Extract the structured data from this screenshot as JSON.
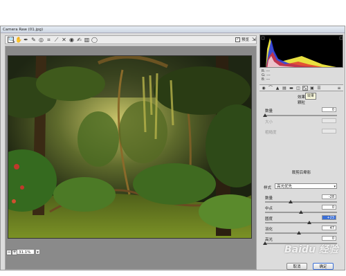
{
  "window": {
    "title": "Camera Raw (01.jpg)"
  },
  "toolbar": {
    "tools": [
      {
        "name": "zoom-tool-icon",
        "glyph": "🔍"
      },
      {
        "name": "hand-tool-icon",
        "glyph": "✋"
      },
      {
        "name": "white-balance-tool-icon",
        "glyph": "✒"
      },
      {
        "name": "color-sampler-tool-icon",
        "glyph": "✎"
      },
      {
        "name": "targeted-adjustment-tool-icon",
        "glyph": "◎"
      },
      {
        "name": "crop-tool-icon",
        "glyph": "⌗"
      },
      {
        "name": "straighten-tool-icon",
        "glyph": "⟋"
      },
      {
        "name": "spot-removal-tool-icon",
        "glyph": "✕"
      },
      {
        "name": "red-eye-tool-icon",
        "glyph": "◉"
      },
      {
        "name": "adjustment-brush-icon",
        "glyph": "✍"
      },
      {
        "name": "graduated-filter-icon",
        "glyph": "▥"
      },
      {
        "name": "radial-filter-icon",
        "glyph": "◯"
      }
    ],
    "preview_label": "预览",
    "preview_checked": "✓"
  },
  "status": {
    "zoom": "31.1%"
  },
  "histogram": {
    "readout": [
      "R: ---",
      "G: ---",
      "B: ---"
    ]
  },
  "panel_tabs": {
    "tooltip": "效果",
    "title": "效果"
  },
  "grain": {
    "heading": "颗粒",
    "amount_label": "数量",
    "amount_value": "0",
    "size_label": "大小",
    "roughness_label": "粗糙度"
  },
  "vignette": {
    "heading": "裁剪后晕影",
    "style_label": "样式",
    "style_value": "高光优先",
    "amount_label": "数量",
    "amount_value": "-28",
    "midpoint_label": "中点",
    "midpoint_value": "0",
    "roundness_label": "圆度",
    "roundness_value": "+23",
    "feather_label": "羽化",
    "feather_value": "47",
    "highlights_label": "高光",
    "highlights_value": "0"
  },
  "buttons": {
    "cancel": "取消",
    "ok": "确定"
  },
  "watermark": "Baidu 经验",
  "sliders": {
    "grain_amount": 0.0,
    "vignette_amount": 0.36,
    "midpoint": 0.5,
    "roundness": 0.62,
    "feather": 0.47,
    "highlights": 0.0
  },
  "colors": {
    "accent": "#3b6fd6"
  }
}
